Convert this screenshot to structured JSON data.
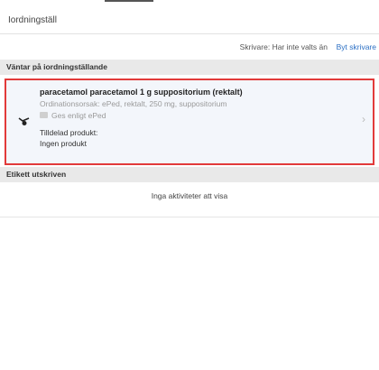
{
  "header": {
    "title": "Iordningställ"
  },
  "printer": {
    "status": "Skrivare: Har inte valts än",
    "change_label": "Byt skrivare"
  },
  "sections": {
    "pending_title": "Väntar på iordningställande",
    "printed_title": "Etikett utskriven"
  },
  "order": {
    "medication": "paracetamol paracetamol 1 g suppositorium (rektalt)",
    "reason": "Ordinationsorsak: ePed, rektalt, 250 mg, suppositorium",
    "instruction": "Ges enligt ePed",
    "assigned_label": "Tilldelad produkt:",
    "assigned_value": "Ingen produkt",
    "icon": "pill-dispense-icon",
    "message_icon": "message-icon",
    "chevron": "›"
  },
  "printed": {
    "empty_text": "Inga aktiviteter att visa"
  },
  "colors": {
    "highlight_border": "#e23a3a",
    "link": "#2b6fc4",
    "card_background": "#f3f6fb",
    "section_background": "#e9e9e9"
  }
}
